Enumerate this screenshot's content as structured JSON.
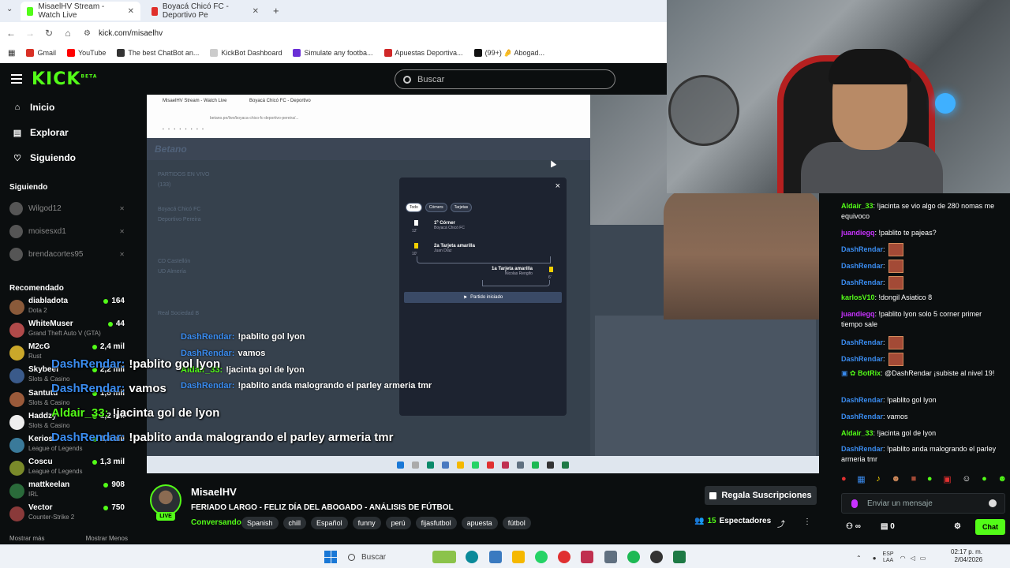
{
  "browser": {
    "tabs": [
      {
        "label": "MisaelHV Stream - Watch Live",
        "color": "#53fc18"
      },
      {
        "label": "Boyacá Chicó FC - Deportivo Pe",
        "color": "#e0302b"
      }
    ],
    "url": "kick.com/misaelhv",
    "bookmarks": [
      {
        "label": "Gmail",
        "color": "#d93025"
      },
      {
        "label": "YouTube",
        "color": "#ff0000"
      },
      {
        "label": "The best ChatBot an...",
        "color": "#333333"
      },
      {
        "label": "KickBot Dashboard",
        "color": "#cccccc"
      },
      {
        "label": "Simulate any footba...",
        "color": "#6a2fd6"
      },
      {
        "label": "Apuestas Deportiva...",
        "color": "#d02828"
      },
      {
        "label": "(99+) 🤌 Abogad...",
        "color": "#111111"
      }
    ]
  },
  "kick": {
    "logo": "KICK",
    "logo_sup": "BETA",
    "search_placeholder": "Buscar"
  },
  "sidebar": {
    "nav": [
      {
        "label": "Inicio",
        "icon": "home-icon",
        "glyph": "⌂"
      },
      {
        "label": "Explorar",
        "icon": "compass-icon",
        "glyph": "▤"
      },
      {
        "label": "Siguiendo",
        "icon": "heart-icon",
        "glyph": "♡"
      }
    ],
    "following_title": "Siguiendo",
    "following": [
      {
        "name": "Wilgod12"
      },
      {
        "name": "moisesxd1"
      },
      {
        "name": "brendacortes95"
      }
    ],
    "recommended_title": "Recomendado",
    "recommended": [
      {
        "name": "diabladota",
        "game": "Dota 2",
        "viewers": "164",
        "color": "#8a5a3a"
      },
      {
        "name": "WhiteMuser",
        "game": "Grand Theft Auto V (GTA)",
        "viewers": "44",
        "color": "#b04a4a"
      },
      {
        "name": "M2cG",
        "game": "Rust",
        "viewers": "2,4 mil",
        "color": "#caa72a"
      },
      {
        "name": "Skybeef",
        "game": "Slots & Casino",
        "viewers": "2,2 mil",
        "color": "#3a5a8a"
      },
      {
        "name": "Santutu",
        "game": "Slots & Casino",
        "viewers": "1,8 mil",
        "color": "#9a5a3a"
      },
      {
        "name": "Haddzy",
        "game": "Slots & Casino",
        "viewers": "1,2 mil",
        "color": "#eeeeee"
      },
      {
        "name": "Kerios",
        "game": "League of Legends",
        "viewers": "1,4 mil",
        "color": "#3a7a9a"
      },
      {
        "name": "Coscu",
        "game": "League of Legends",
        "viewers": "1,3 mil",
        "color": "#7a8a2a"
      },
      {
        "name": "mattkeelan",
        "game": "IRL",
        "viewers": "908",
        "color": "#2a6a3a"
      },
      {
        "name": "Vector",
        "game": "Counter-Strike 2",
        "viewers": "750",
        "color": "#8a3a3a"
      }
    ],
    "show_more": "Mostrar más",
    "show_less": "Mostrar Menos"
  },
  "video": {
    "inner_tab1": "MisaelHV Stream - Watch Live",
    "inner_tab2": "Boyacá Chicó FC - Deportivo",
    "inner_url": "betano.pe/live/boyaca-chico-fc-deportivo-pereira/...",
    "inner_brand": "Betano",
    "inner_list": [
      "PARTIDOS EN VIVO",
      "(133)",
      "Boyacá Chicó FC",
      "Deportivo Pereira",
      "CD Castellón",
      "UD Almería",
      "Real Sociedad B"
    ],
    "modal": {
      "close": "×",
      "pills": [
        "Todo",
        "Córners",
        "Tarjetas"
      ],
      "events": [
        {
          "title": "1º Córner",
          "sub": "Boyacá Chicó FC",
          "minute": "12'"
        },
        {
          "title": "2a Tarjeta amarilla",
          "sub": "Juan Díaz",
          "minute": "10'"
        },
        {
          "title": "1a Tarjeta amarilla",
          "sub": "Nicolas Rengifo",
          "minute": "6'"
        }
      ],
      "start": "Partido iniciado"
    },
    "overlay_small": [
      {
        "user": "DashRendar:",
        "text": "!pablito gol lyon",
        "color": "blue"
      },
      {
        "user": "DashRendar:",
        "text": "vamos",
        "color": "blue"
      },
      {
        "user": "Aldair_33:",
        "text": "!jacinta gol de lyon",
        "color": "green"
      },
      {
        "user": "DashRendar:",
        "text": "!pablito anda malogrando el parley armeria tmr",
        "color": "blue"
      }
    ],
    "overlay_large": [
      {
        "user": "DashRendar:",
        "text": "!pablito gol lyon",
        "color": "blue"
      },
      {
        "user": "DashRendar:",
        "text": "vamos",
        "color": "blue"
      },
      {
        "user": "Aldair_33:",
        "text": "!jacinta gol de lyon",
        "color": "green"
      },
      {
        "user": "DashRendar:",
        "text": "!pablito anda malogrando el parley armeria tmr",
        "color": "blue"
      }
    ]
  },
  "chat": {
    "messages": [
      {
        "user": "Aldair_33",
        "color": "#53fc18",
        "text": "!jacinta se vio algo de 280 nomas me equivoco"
      },
      {
        "user": "juandiegq",
        "color": "#c832ff",
        "text": "!pablito te pajeas?"
      },
      {
        "user": "DashRendar",
        "color": "#3a8cf0",
        "text": "",
        "emote": true
      },
      {
        "user": "DashRendar",
        "color": "#3a8cf0",
        "text": "",
        "emote": true
      },
      {
        "user": "DashRendar",
        "color": "#3a8cf0",
        "text": "",
        "emote": true
      },
      {
        "user": "karlosV10",
        "color": "#53fc18",
        "text": "!dongil Asiatico 8"
      },
      {
        "user": "juandiegq",
        "color": "#c832ff",
        "text": "!pablito lyon solo 5 corner primer tiempo sale"
      },
      {
        "user": "DashRendar",
        "color": "#3a8cf0",
        "text": "",
        "emote": true
      },
      {
        "user": "DashRendar",
        "color": "#3a8cf0",
        "text": "",
        "emote": true
      },
      {
        "user": "BotRix",
        "color": "#53fc18",
        "text": "@DashRendar ¡subiste al nivel 19!"
      },
      {
        "user": "DashRendar",
        "color": "#3a8cf0",
        "text": "!pablito gol lyon"
      },
      {
        "user": "DashRendar",
        "color": "#3a8cf0",
        "text": "vamos"
      },
      {
        "user": "Aldair_33",
        "color": "#53fc18",
        "text": "!jacinta gol de lyon"
      },
      {
        "user": "DashRendar",
        "color": "#3a8cf0",
        "text": "!pablito anda malogrando el parley armeria tmr"
      }
    ],
    "input_placeholder": "Enviar un mensaje",
    "points": "∞",
    "gifts": "0",
    "send_label": "Chat"
  },
  "stream": {
    "name": "MisaelHV",
    "title": "FERIADO LARGO - FELIZ DÍA DEL ABOGADO - ANÁLISIS DE FÚTBOL",
    "category": "Conversando",
    "tags": [
      "Spanish",
      "chill",
      "Español",
      "funny",
      "perú",
      "fijasfutbol",
      "apuesta",
      "fútbol"
    ],
    "live": "LIVE",
    "subscribe": "Regala Suscripciones",
    "viewers": "15",
    "viewers_label": "Espectadores"
  },
  "taskbar": {
    "search": "Buscar",
    "lang_top": "ESP",
    "lang_bottom": "LAA",
    "time": "02:17 p. m.",
    "date": "2/04/2026"
  }
}
